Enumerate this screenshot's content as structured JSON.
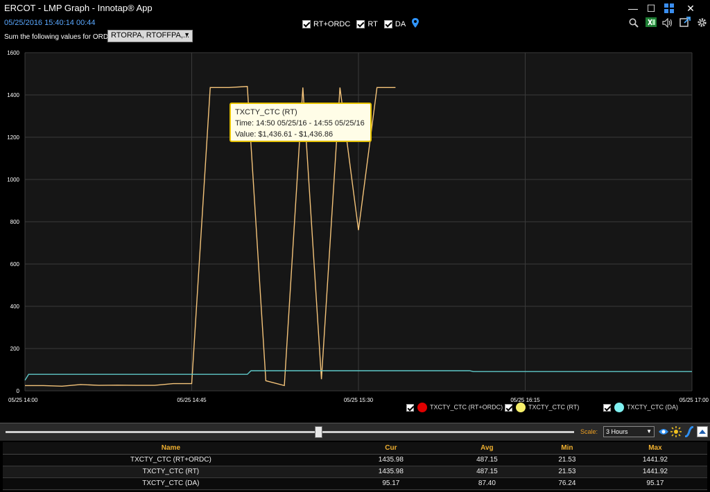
{
  "window": {
    "title": "ERCOT - LMP Graph - Innotap® App",
    "minimize": "—",
    "maximize": "☐",
    "close": "✕"
  },
  "toolbar": {
    "timestamp": "05/25/2016 15:40:14  00:44",
    "sum_label": "Sum the following values for ORDC",
    "ordc_select": "RTORPA, RTOFFPA,...",
    "toggles": [
      {
        "label": "RT+ORDC",
        "checked": true
      },
      {
        "label": "RT",
        "checked": true
      },
      {
        "label": "DA",
        "checked": true
      }
    ],
    "icons": [
      "search-icon",
      "excel-icon",
      "speaker-icon",
      "popout-icon",
      "gear-icon"
    ]
  },
  "chart_data": {
    "type": "line",
    "ylim": [
      0,
      1600
    ],
    "yticks": [
      0,
      200,
      400,
      600,
      800,
      1000,
      1200,
      1400,
      1600
    ],
    "xtick_labels": [
      "05/25 14:00",
      "05/25 14:45",
      "05/25 15:30",
      "05/25 16:15",
      "05/25 17:00"
    ],
    "xrange_minutes": [
      0,
      180
    ],
    "series": [
      {
        "name": "TXCTY_CTC (RT)",
        "color": "#f5c47a",
        "x": [
          0,
          5,
          10,
          15,
          20,
          25,
          30,
          35,
          40,
          45,
          50,
          55,
          60,
          65,
          70,
          75,
          80,
          85,
          90,
          95,
          100
        ],
        "y": [
          25,
          25,
          22,
          30,
          26,
          27,
          26,
          26,
          34,
          34,
          1435,
          1435,
          1440,
          48,
          25,
          1435,
          55,
          1435,
          760,
          1435,
          1435
        ]
      },
      {
        "name": "TXCTY_CTC (DA)",
        "color": "#5fc8c8",
        "x": [
          0,
          1,
          60,
          61,
          120,
          121,
          180
        ],
        "y": [
          50,
          78,
          78,
          95,
          95,
          91,
          91
        ]
      }
    ],
    "legend": [
      {
        "label": "TXCTY_CTC (RT+ORDC)",
        "color": "#e00000",
        "checked": true
      },
      {
        "label": "TXCTY_CTC (RT)",
        "color": "#f6ef6a",
        "checked": true
      },
      {
        "label": "TXCTY_CTC (DA)",
        "color": "#7ff0f0",
        "checked": true
      }
    ]
  },
  "tooltip": {
    "title": "TXCTY_CTC (RT)",
    "time": "Time: 14:50 05/25/16 - 14:55 05/25/16",
    "value": "Value: $1,436.61 - $1,436.86"
  },
  "slider": {
    "scale_label": "Scale:",
    "scale_value": "3 Hours",
    "position_fraction": 0.55
  },
  "stats": {
    "headers": [
      "Name",
      "Cur",
      "Avg",
      "Min",
      "Max"
    ],
    "rows": [
      [
        "TXCTY_CTC (RT+ORDC)",
        "1435.98",
        "487.15",
        "21.53",
        "1441.92"
      ],
      [
        "TXCTY_CTC (RT)",
        "1435.98",
        "487.15",
        "21.53",
        "1441.92"
      ],
      [
        "TXCTY_CTC (DA)",
        "95.17",
        "87.40",
        "76.24",
        "95.17"
      ]
    ]
  }
}
